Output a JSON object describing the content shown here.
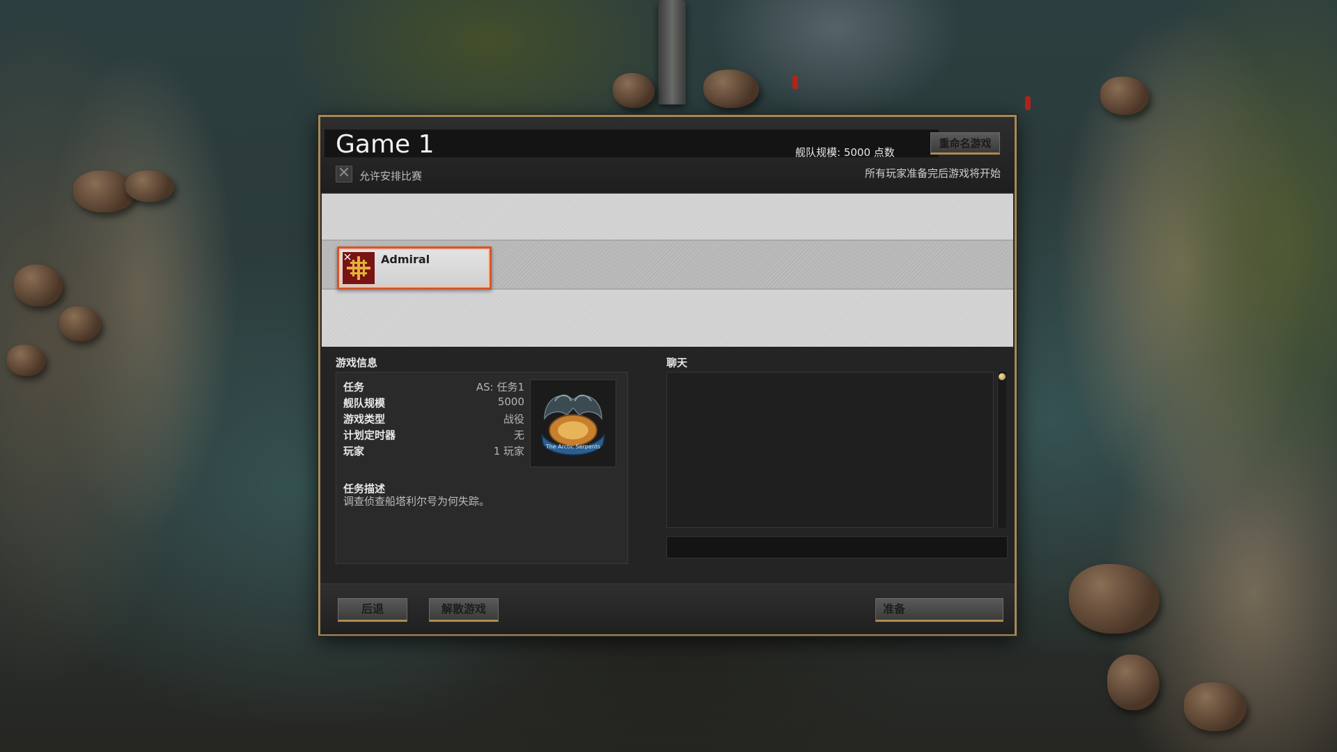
{
  "lobby": {
    "game_title": "Game 1",
    "fleet_size_info": "舰队规模: 5000 点数",
    "rename_button": "重命名游戏",
    "allow_matchmaking_label": "允许安排比赛",
    "all_ready_note": "所有玩家准备完后游戏将开始"
  },
  "players": [
    {
      "name": "Admiral"
    }
  ],
  "game_info": {
    "heading": "游戏信息",
    "rows": [
      {
        "key": "任务",
        "value": "AS: 任务1"
      },
      {
        "key": "舰队规模",
        "value": "5000"
      },
      {
        "key": "游戏类型",
        "value": "战役"
      },
      {
        "key": "计划定时器",
        "value": "无"
      },
      {
        "key": "玩家",
        "value": "1 玩家"
      }
    ],
    "badge_text": "The Arctic Serpents",
    "description_title": "任务描述",
    "description_text": "调查侦查船塔利尔号为何失踪。"
  },
  "chat": {
    "heading": "聊天",
    "input_value": ""
  },
  "footer": {
    "back_button": "后退",
    "disband_button": "解散游戏",
    "ready_button": "准备"
  }
}
